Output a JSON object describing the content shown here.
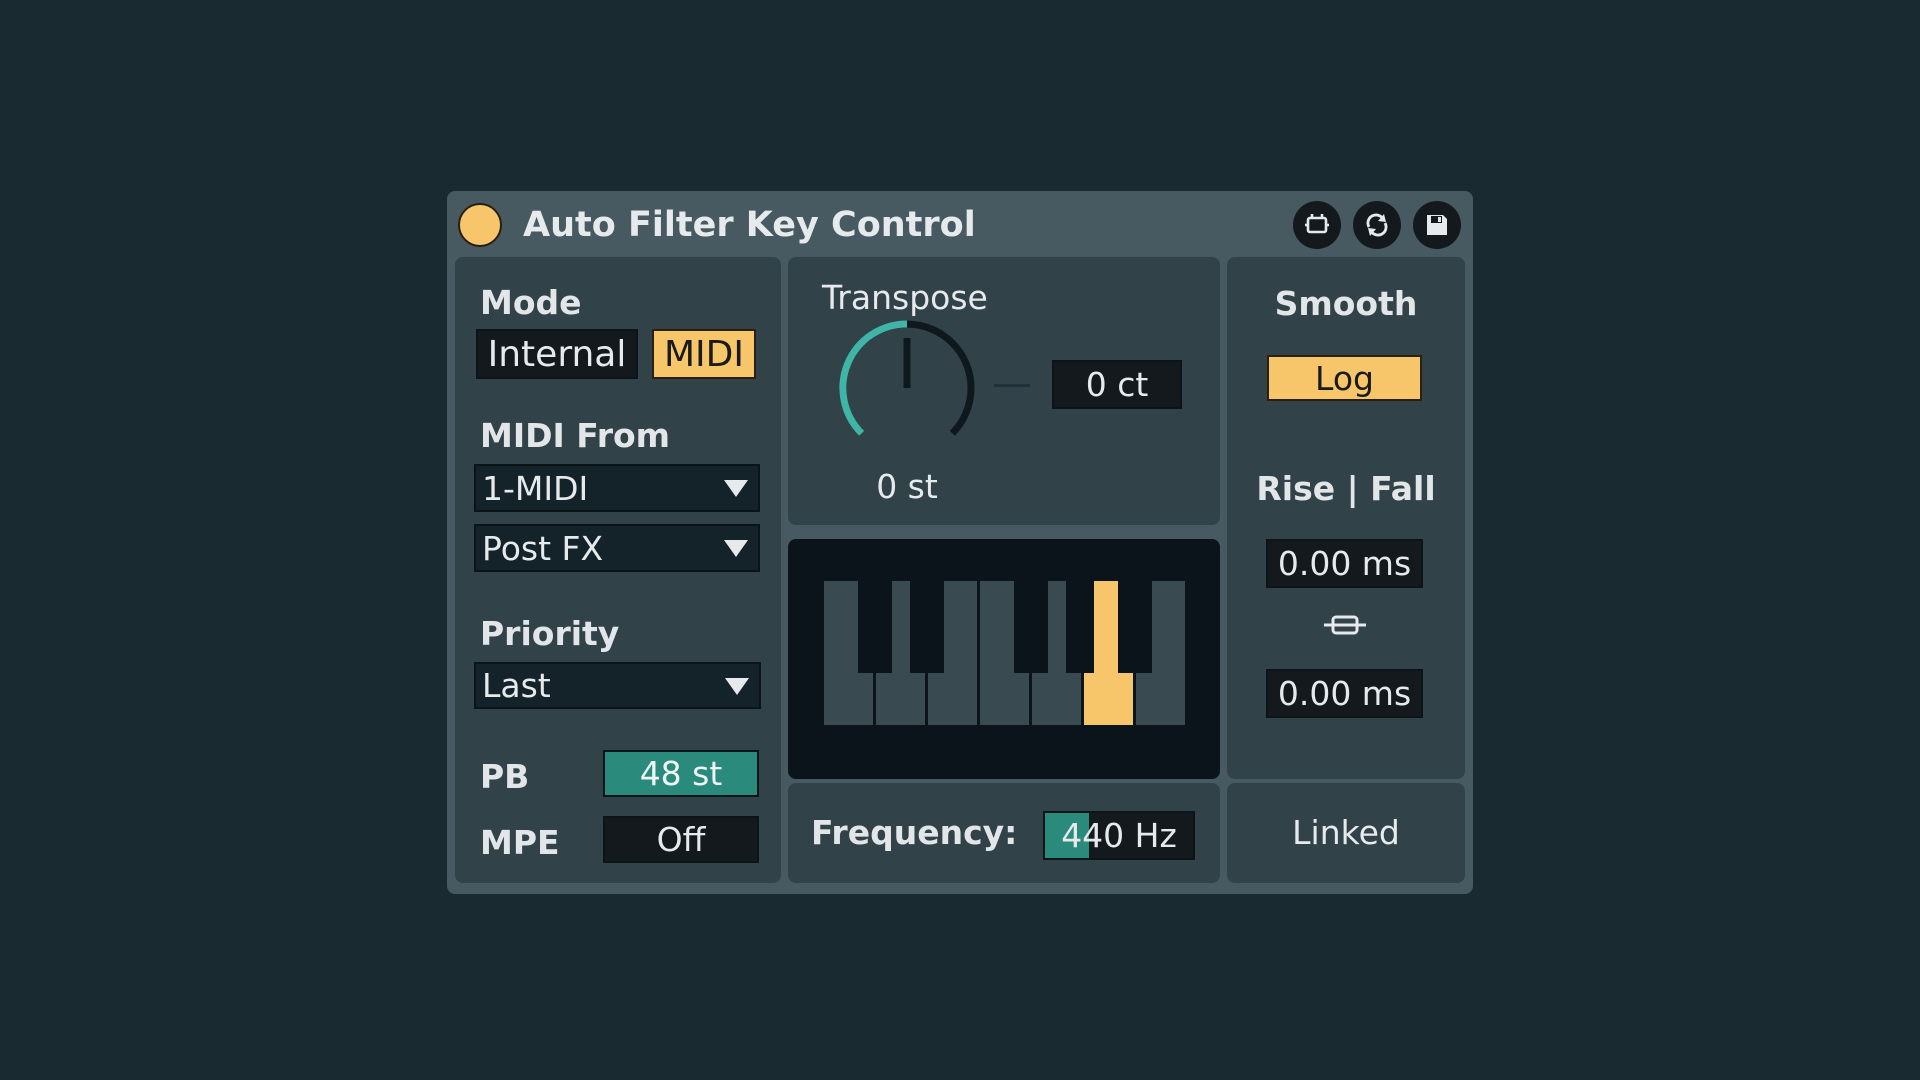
{
  "device": {
    "title": "Auto Filter Key Control",
    "power_color": "#f7c66a",
    "accent_orange": "#f7c66a",
    "accent_teal": "#3fb5a8",
    "header_buttons": [
      {
        "icon": "map-mode-icon"
      },
      {
        "icon": "sync-icon"
      },
      {
        "icon": "save-icon"
      }
    ]
  },
  "mode": {
    "label": "Mode",
    "options": [
      "Internal",
      "MIDI"
    ],
    "selected": "MIDI"
  },
  "midi_from": {
    "label": "MIDI From",
    "source": "1-MIDI",
    "tap": "Post FX"
  },
  "priority": {
    "label": "Priority",
    "value": "Last"
  },
  "pb": {
    "label": "PB",
    "value": "48 st"
  },
  "mpe": {
    "label": "MPE",
    "value": "Off"
  },
  "transpose": {
    "label": "Transpose",
    "semitones": "0 st",
    "cents": "0 ct",
    "knob_level": 0.5
  },
  "keyboard": {
    "active_key": "A"
  },
  "frequency": {
    "label": "Frequency:",
    "value": "440 Hz"
  },
  "smooth": {
    "label": "Smooth",
    "mode": "Log",
    "rise_fall_label": "Rise | Fall",
    "rise": "0.00 ms",
    "fall": "0.00 ms",
    "link_icon": "link-icon",
    "linked_label": "Linked"
  }
}
